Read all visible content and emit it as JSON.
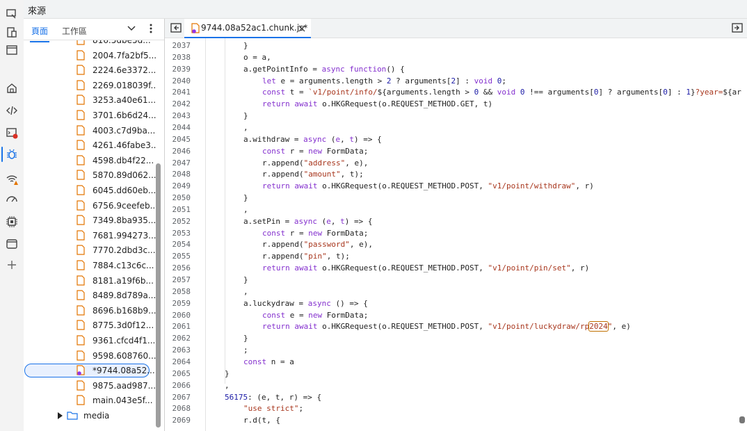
{
  "panel_title": "來源",
  "sidebar": {
    "tabs": [
      "頁面",
      "工作區"
    ],
    "files": [
      "816.5dbe5d...",
      "2004.7fa2bf5...",
      "2224.6e3372...",
      "2269.018039f...",
      "3253.a40e61...",
      "3701.6b6d24...",
      "4003.c7d9ba...",
      "4261.46fabe3...",
      "4598.db4f22...",
      "5870.89d062...",
      "6045.dd60eb...",
      "6756.9ceefeb...",
      "7349.8ba935...",
      "7681.994273...",
      "7770.2dbd3c...",
      "7884.c13c6c...",
      "8181.a19f6b...",
      "8489.8d789a...",
      "8696.b168b9...",
      "8775.3d0f12...",
      "9361.cfcd4f1...",
      "9598.608760...",
      "*9744.08a52...",
      "9875.aad987...",
      "main.043e5f..."
    ],
    "selected_index": 22,
    "folder": "media"
  },
  "editor": {
    "tab_label": "9744.08a52ac1.chunk.js*",
    "lines": [
      {
        "n": "2037",
        "ind": 1,
        "code": [
          [
            "p",
            "}"
          ]
        ]
      },
      {
        "n": "2038",
        "ind": 1,
        "code": [
          [
            "p",
            "o = a,"
          ]
        ]
      },
      {
        "n": "2039",
        "ind": 1,
        "code": [
          [
            "p",
            "a.getPointInfo = "
          ],
          [
            "k",
            "async function"
          ],
          [
            "p",
            "() {"
          ]
        ]
      },
      {
        "n": "2040",
        "ind": 2,
        "code": [
          [
            "k",
            "let"
          ],
          [
            "p",
            " e = arguments.length > "
          ],
          [
            "n",
            "2"
          ],
          [
            "p",
            " ? arguments["
          ],
          [
            "n",
            "2"
          ],
          [
            "p",
            "] : "
          ],
          [
            "k",
            "void"
          ],
          [
            "p",
            " "
          ],
          [
            "n",
            "0"
          ],
          [
            "p",
            ";"
          ]
        ]
      },
      {
        "n": "2041",
        "ind": 2,
        "code": [
          [
            "k",
            "const"
          ],
          [
            "p",
            " t = "
          ],
          [
            "s",
            "`v1/point/info/"
          ],
          [
            "p",
            "${arguments.length > "
          ],
          [
            "n",
            "0"
          ],
          [
            "p",
            " && "
          ],
          [
            "k",
            "void"
          ],
          [
            "p",
            " "
          ],
          [
            "n",
            "0"
          ],
          [
            "p",
            " !== arguments["
          ],
          [
            "n",
            "0"
          ],
          [
            "p",
            "] ? arguments["
          ],
          [
            "n",
            "0"
          ],
          [
            "p",
            "] : "
          ],
          [
            "n",
            "1"
          ],
          [
            "p",
            "}"
          ],
          [
            "s",
            "?year="
          ],
          [
            "p",
            "${ar"
          ]
        ]
      },
      {
        "n": "2042",
        "ind": 2,
        "code": [
          [
            "k",
            "return await"
          ],
          [
            "p",
            " o.HKGRequest(o.REQUEST_METHOD.GET, t)"
          ]
        ]
      },
      {
        "n": "2043",
        "ind": 1,
        "code": [
          [
            "p",
            "}"
          ]
        ]
      },
      {
        "n": "2044",
        "ind": 1,
        "code": [
          [
            "p",
            ","
          ]
        ]
      },
      {
        "n": "2045",
        "ind": 1,
        "code": [
          [
            "p",
            "a.withdraw = "
          ],
          [
            "k",
            "async"
          ],
          [
            "p",
            " ("
          ],
          [
            "k",
            "e"
          ],
          [
            "p",
            ", "
          ],
          [
            "k",
            "t"
          ],
          [
            "p",
            ") => {"
          ]
        ]
      },
      {
        "n": "2046",
        "ind": 2,
        "code": [
          [
            "k",
            "const"
          ],
          [
            "p",
            " r = "
          ],
          [
            "k",
            "new"
          ],
          [
            "p",
            " FormData;"
          ]
        ]
      },
      {
        "n": "2047",
        "ind": 2,
        "code": [
          [
            "p",
            "r.append("
          ],
          [
            "s",
            "\"address\""
          ],
          [
            "p",
            ", e),"
          ]
        ]
      },
      {
        "n": "2048",
        "ind": 2,
        "code": [
          [
            "p",
            "r.append("
          ],
          [
            "s",
            "\"amount\""
          ],
          [
            "p",
            ", t);"
          ]
        ]
      },
      {
        "n": "2049",
        "ind": 2,
        "code": [
          [
            "k",
            "return await"
          ],
          [
            "p",
            " o.HKGRequest(o.REQUEST_METHOD.POST, "
          ],
          [
            "s",
            "\"v1/point/withdraw\""
          ],
          [
            "p",
            ", r)"
          ]
        ]
      },
      {
        "n": "2050",
        "ind": 1,
        "code": [
          [
            "p",
            "}"
          ]
        ]
      },
      {
        "n": "2051",
        "ind": 1,
        "code": [
          [
            "p",
            ","
          ]
        ]
      },
      {
        "n": "2052",
        "ind": 1,
        "code": [
          [
            "p",
            "a.setPin = "
          ],
          [
            "k",
            "async"
          ],
          [
            "p",
            " ("
          ],
          [
            "k",
            "e"
          ],
          [
            "p",
            ", "
          ],
          [
            "k",
            "t"
          ],
          [
            "p",
            ") => {"
          ]
        ]
      },
      {
        "n": "2053",
        "ind": 2,
        "code": [
          [
            "k",
            "const"
          ],
          [
            "p",
            " r = "
          ],
          [
            "k",
            "new"
          ],
          [
            "p",
            " FormData;"
          ]
        ]
      },
      {
        "n": "2054",
        "ind": 2,
        "code": [
          [
            "p",
            "r.append("
          ],
          [
            "s",
            "\"password\""
          ],
          [
            "p",
            ", e),"
          ]
        ]
      },
      {
        "n": "2055",
        "ind": 2,
        "code": [
          [
            "p",
            "r.append("
          ],
          [
            "s",
            "\"pin\""
          ],
          [
            "p",
            ", t);"
          ]
        ]
      },
      {
        "n": "2056",
        "ind": 2,
        "code": [
          [
            "k",
            "return await"
          ],
          [
            "p",
            " o.HKGRequest(o.REQUEST_METHOD.POST, "
          ],
          [
            "s",
            "\"v1/point/pin/set\""
          ],
          [
            "p",
            ", r)"
          ]
        ]
      },
      {
        "n": "2057",
        "ind": 1,
        "code": [
          [
            "p",
            "}"
          ]
        ]
      },
      {
        "n": "2058",
        "ind": 1,
        "code": [
          [
            "p",
            ","
          ]
        ]
      },
      {
        "n": "2059",
        "ind": 1,
        "code": [
          [
            "p",
            "a.luckydraw = "
          ],
          [
            "k",
            "async"
          ],
          [
            "p",
            " () => {"
          ]
        ]
      },
      {
        "n": "2060",
        "ind": 2,
        "code": [
          [
            "k",
            "const"
          ],
          [
            "p",
            " e = "
          ],
          [
            "k",
            "new"
          ],
          [
            "p",
            " FormData;"
          ]
        ]
      },
      {
        "n": "2061",
        "ind": 2,
        "code": [
          [
            "k",
            "return await"
          ],
          [
            "p",
            " o.HKGRequest(o.REQUEST_METHOD.POST, "
          ],
          [
            "s",
            "\"v1/point/luckydraw/rp"
          ],
          [
            "h",
            "2024"
          ],
          [
            "s",
            "\""
          ],
          [
            "p",
            ", e)"
          ]
        ]
      },
      {
        "n": "2062",
        "ind": 1,
        "code": [
          [
            "p",
            "}"
          ]
        ]
      },
      {
        "n": "2063",
        "ind": 1,
        "code": [
          [
            "p",
            ";"
          ]
        ]
      },
      {
        "n": "2064",
        "ind": 1,
        "code": [
          [
            "k",
            "const"
          ],
          [
            "p",
            " n = a"
          ]
        ]
      },
      {
        "n": "2065",
        "ind": 0,
        "code": [
          [
            "p",
            "}"
          ]
        ]
      },
      {
        "n": "2066",
        "ind": 0,
        "code": [
          [
            "p",
            ","
          ]
        ]
      },
      {
        "n": "2067",
        "ind": 0,
        "code": [
          [
            "n",
            "56175"
          ],
          [
            "p",
            ": (e, t, r) => {"
          ]
        ]
      },
      {
        "n": "2068",
        "ind": 1,
        "code": [
          [
            "s",
            "\"use strict\""
          ],
          [
            "p",
            ";"
          ]
        ]
      },
      {
        "n": "2069",
        "ind": 1,
        "code": [
          [
            "p",
            "r.d(t, {"
          ]
        ]
      }
    ]
  },
  "icons": [
    "device-mode-icon",
    "inspect-icon",
    "window-icon",
    "home-icon",
    "code-icon",
    "console-icon",
    "bug-icon",
    "wifi-warning-icon",
    "performance-icon",
    "cpu-icon",
    "application-icon",
    "add-icon"
  ]
}
